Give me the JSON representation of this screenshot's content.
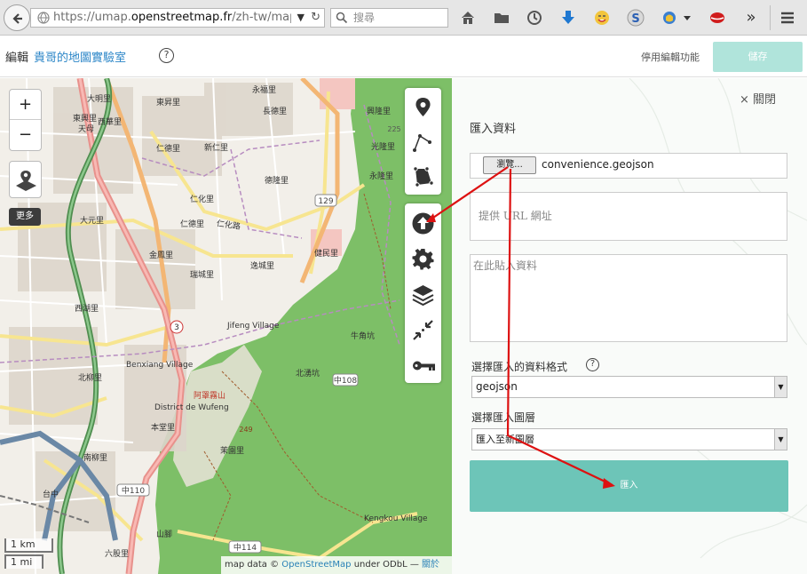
{
  "browser": {
    "url_prefix": "https://umap.",
    "url_domain": "openstreetmap.fr",
    "url_suffix": "/zh-tw/map",
    "search_placeholder": "搜尋",
    "overflow": "»"
  },
  "header": {
    "edit_label": "編輯",
    "map_name": "貴哥的地圖實驗室",
    "help": "?",
    "disable_edit": "停用編輯功能",
    "save": "儲存"
  },
  "map": {
    "zoom_in": "+",
    "zoom_out": "−",
    "more": "更多",
    "scale_km": "1 km",
    "scale_mi": "1 mi",
    "attribution_prefix": "map data ©",
    "attribution_link": "OpenStreetMap",
    "attribution_license": "under ODbL —",
    "attribution_about": "關於",
    "labels": [
      "大明里",
      "東昇里",
      "天母",
      "東興里",
      "西華里",
      "仁德里",
      "永福里",
      "長德里",
      "興隆里",
      "光隆里",
      "永隆里",
      "新仁里",
      "德隆里",
      "仁化里",
      "大元里",
      "仁德里",
      "仁化路",
      "金鳳里",
      "瑞城里",
      "健民里",
      "逸城里",
      "西湖里",
      "北柳里",
      "Benxiang Village",
      "Jifeng Village",
      "牛角坑",
      "北湧坑",
      "阿罩霧山",
      "District de Wufeng",
      "本堂里",
      "茉園里",
      "南柳里",
      "台中",
      "Kengkou Village",
      "六股里",
      "山腳",
      "新平村"
    ],
    "road_numbers": [
      "129",
      "225",
      "3",
      "108",
      "110",
      "114",
      "249"
    ]
  },
  "panel": {
    "close": "× 關閉",
    "title": "匯入資料",
    "browse": "瀏覽...",
    "file_name": "convenience.geojson",
    "url_placeholder": "提供 URL 網址",
    "paste_placeholder": "在此貼入資料",
    "format_label": "選擇匯入的資料格式",
    "format_help": "?",
    "format_value": "geojson",
    "layer_label": "選擇匯入圖層",
    "layer_value": "匯入至新圖層",
    "import": "匯入"
  },
  "colors": {
    "forest": "#7dbf67",
    "accent": "#6dc5b8",
    "link": "#2d87c8",
    "annotation": "#dd1111"
  }
}
